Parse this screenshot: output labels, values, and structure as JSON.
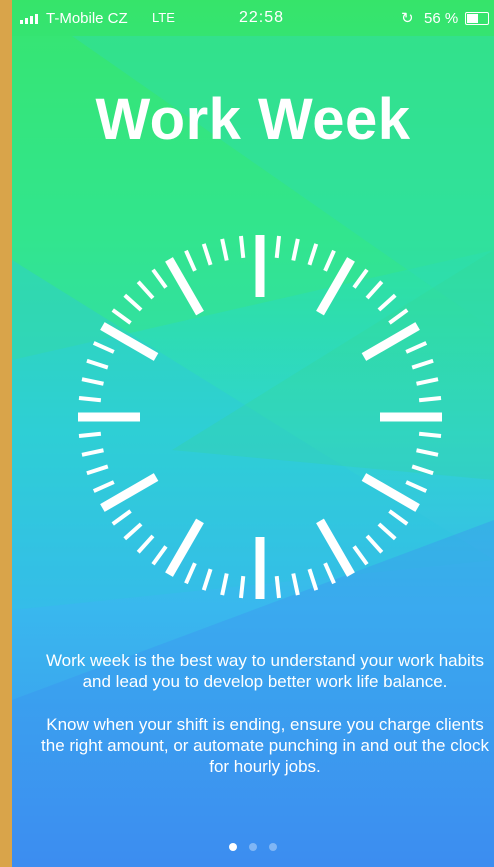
{
  "status_bar": {
    "carrier": "T-Mobile CZ",
    "network": "LTE",
    "time": "22:58",
    "battery_percent": "56 %",
    "battery_level": 0.56,
    "icons": [
      "signal-icon",
      "rotation-lock-icon",
      "battery-icon"
    ]
  },
  "intro": {
    "title": "Work Week",
    "description": [
      "Work week is the best way to understand your work habits and lead you to develop better work life balance.",
      "Know when your shift is ending, ensure you charge clients the right amount, or automate punching in and out the clock for hourly jobs."
    ],
    "illustration": "clock-face-icon"
  },
  "pagination": {
    "pages": 3,
    "current": 1
  },
  "colors": {
    "gradient_top": "#36e46a",
    "gradient_mid": "#2fd4d0",
    "gradient_bottom": "#3d8cf0",
    "text": "#ffffff"
  }
}
